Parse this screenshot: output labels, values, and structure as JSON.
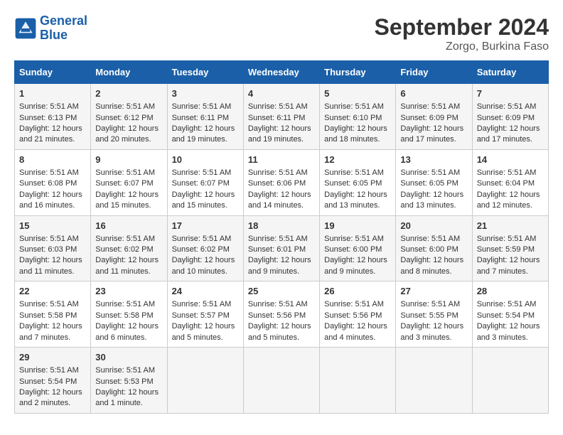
{
  "header": {
    "logo_line1": "General",
    "logo_line2": "Blue",
    "month": "September 2024",
    "location": "Zorgo, Burkina Faso"
  },
  "days_of_week": [
    "Sunday",
    "Monday",
    "Tuesday",
    "Wednesday",
    "Thursday",
    "Friday",
    "Saturday"
  ],
  "weeks": [
    [
      {
        "day": "1",
        "lines": [
          "Sunrise: 5:51 AM",
          "Sunset: 6:13 PM",
          "Daylight: 12 hours",
          "and 21 minutes."
        ]
      },
      {
        "day": "2",
        "lines": [
          "Sunrise: 5:51 AM",
          "Sunset: 6:12 PM",
          "Daylight: 12 hours",
          "and 20 minutes."
        ]
      },
      {
        "day": "3",
        "lines": [
          "Sunrise: 5:51 AM",
          "Sunset: 6:11 PM",
          "Daylight: 12 hours",
          "and 19 minutes."
        ]
      },
      {
        "day": "4",
        "lines": [
          "Sunrise: 5:51 AM",
          "Sunset: 6:11 PM",
          "Daylight: 12 hours",
          "and 19 minutes."
        ]
      },
      {
        "day": "5",
        "lines": [
          "Sunrise: 5:51 AM",
          "Sunset: 6:10 PM",
          "Daylight: 12 hours",
          "and 18 minutes."
        ]
      },
      {
        "day": "6",
        "lines": [
          "Sunrise: 5:51 AM",
          "Sunset: 6:09 PM",
          "Daylight: 12 hours",
          "and 17 minutes."
        ]
      },
      {
        "day": "7",
        "lines": [
          "Sunrise: 5:51 AM",
          "Sunset: 6:09 PM",
          "Daylight: 12 hours",
          "and 17 minutes."
        ]
      }
    ],
    [
      {
        "day": "8",
        "lines": [
          "Sunrise: 5:51 AM",
          "Sunset: 6:08 PM",
          "Daylight: 12 hours",
          "and 16 minutes."
        ]
      },
      {
        "day": "9",
        "lines": [
          "Sunrise: 5:51 AM",
          "Sunset: 6:07 PM",
          "Daylight: 12 hours",
          "and 15 minutes."
        ]
      },
      {
        "day": "10",
        "lines": [
          "Sunrise: 5:51 AM",
          "Sunset: 6:07 PM",
          "Daylight: 12 hours",
          "and 15 minutes."
        ]
      },
      {
        "day": "11",
        "lines": [
          "Sunrise: 5:51 AM",
          "Sunset: 6:06 PM",
          "Daylight: 12 hours",
          "and 14 minutes."
        ]
      },
      {
        "day": "12",
        "lines": [
          "Sunrise: 5:51 AM",
          "Sunset: 6:05 PM",
          "Daylight: 12 hours",
          "and 13 minutes."
        ]
      },
      {
        "day": "13",
        "lines": [
          "Sunrise: 5:51 AM",
          "Sunset: 6:05 PM",
          "Daylight: 12 hours",
          "and 13 minutes."
        ]
      },
      {
        "day": "14",
        "lines": [
          "Sunrise: 5:51 AM",
          "Sunset: 6:04 PM",
          "Daylight: 12 hours",
          "and 12 minutes."
        ]
      }
    ],
    [
      {
        "day": "15",
        "lines": [
          "Sunrise: 5:51 AM",
          "Sunset: 6:03 PM",
          "Daylight: 12 hours",
          "and 11 minutes."
        ]
      },
      {
        "day": "16",
        "lines": [
          "Sunrise: 5:51 AM",
          "Sunset: 6:02 PM",
          "Daylight: 12 hours",
          "and 11 minutes."
        ]
      },
      {
        "day": "17",
        "lines": [
          "Sunrise: 5:51 AM",
          "Sunset: 6:02 PM",
          "Daylight: 12 hours",
          "and 10 minutes."
        ]
      },
      {
        "day": "18",
        "lines": [
          "Sunrise: 5:51 AM",
          "Sunset: 6:01 PM",
          "Daylight: 12 hours",
          "and 9 minutes."
        ]
      },
      {
        "day": "19",
        "lines": [
          "Sunrise: 5:51 AM",
          "Sunset: 6:00 PM",
          "Daylight: 12 hours",
          "and 9 minutes."
        ]
      },
      {
        "day": "20",
        "lines": [
          "Sunrise: 5:51 AM",
          "Sunset: 6:00 PM",
          "Daylight: 12 hours",
          "and 8 minutes."
        ]
      },
      {
        "day": "21",
        "lines": [
          "Sunrise: 5:51 AM",
          "Sunset: 5:59 PM",
          "Daylight: 12 hours",
          "and 7 minutes."
        ]
      }
    ],
    [
      {
        "day": "22",
        "lines": [
          "Sunrise: 5:51 AM",
          "Sunset: 5:58 PM",
          "Daylight: 12 hours",
          "and 7 minutes."
        ]
      },
      {
        "day": "23",
        "lines": [
          "Sunrise: 5:51 AM",
          "Sunset: 5:58 PM",
          "Daylight: 12 hours",
          "and 6 minutes."
        ]
      },
      {
        "day": "24",
        "lines": [
          "Sunrise: 5:51 AM",
          "Sunset: 5:57 PM",
          "Daylight: 12 hours",
          "and 5 minutes."
        ]
      },
      {
        "day": "25",
        "lines": [
          "Sunrise: 5:51 AM",
          "Sunset: 5:56 PM",
          "Daylight: 12 hours",
          "and 5 minutes."
        ]
      },
      {
        "day": "26",
        "lines": [
          "Sunrise: 5:51 AM",
          "Sunset: 5:56 PM",
          "Daylight: 12 hours",
          "and 4 minutes."
        ]
      },
      {
        "day": "27",
        "lines": [
          "Sunrise: 5:51 AM",
          "Sunset: 5:55 PM",
          "Daylight: 12 hours",
          "and 3 minutes."
        ]
      },
      {
        "day": "28",
        "lines": [
          "Sunrise: 5:51 AM",
          "Sunset: 5:54 PM",
          "Daylight: 12 hours",
          "and 3 minutes."
        ]
      }
    ],
    [
      {
        "day": "29",
        "lines": [
          "Sunrise: 5:51 AM",
          "Sunset: 5:54 PM",
          "Daylight: 12 hours",
          "and 2 minutes."
        ]
      },
      {
        "day": "30",
        "lines": [
          "Sunrise: 5:51 AM",
          "Sunset: 5:53 PM",
          "Daylight: 12 hours",
          "and 1 minute."
        ]
      },
      {
        "day": "",
        "lines": []
      },
      {
        "day": "",
        "lines": []
      },
      {
        "day": "",
        "lines": []
      },
      {
        "day": "",
        "lines": []
      },
      {
        "day": "",
        "lines": []
      }
    ]
  ]
}
